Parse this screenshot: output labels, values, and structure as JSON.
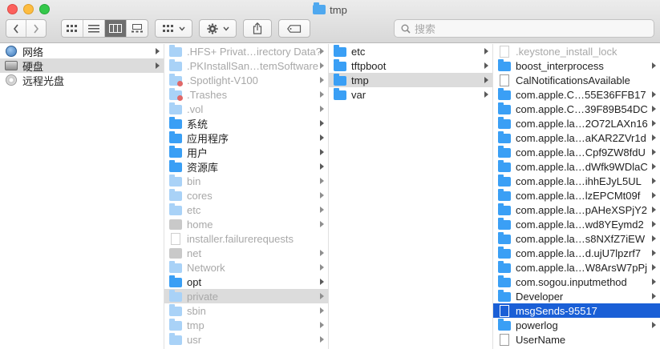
{
  "window": {
    "title": "tmp"
  },
  "toolbar": {
    "back_icon": "chevron-left-icon",
    "forward_icon": "chevron-right-icon",
    "view_modes": [
      "icon-view-icon",
      "list-view-icon",
      "column-view-icon",
      "gallery-view-icon"
    ],
    "active_view": "column-view-icon",
    "group_icon": "group-grid-icon",
    "action_icon": "gear-icon",
    "share_icon": "share-icon",
    "tag_icon": "tag-icon",
    "search_placeholder": "搜索"
  },
  "colors": {
    "selection_blue": "#1a5fd6",
    "selection_gray": "#dcdcdc",
    "folder_blue": "#3a9ff5",
    "folder_dim": "#a9d2f7"
  },
  "columns": [
    {
      "items": [
        {
          "label": "网络",
          "icon": "globe-icon",
          "dim": false,
          "arrow": true,
          "selected": ""
        },
        {
          "label": "硬盘",
          "icon": "hard-disk-icon",
          "dim": false,
          "arrow": true,
          "selected": "gray"
        },
        {
          "label": "远程光盘",
          "icon": "optical-disc-icon",
          "dim": false,
          "arrow": false,
          "selected": ""
        }
      ]
    },
    {
      "items": [
        {
          "label": ".HFS+ Privat…irectory Data?",
          "icon": "folder-icon",
          "dim": true,
          "arrow": true,
          "selected": ""
        },
        {
          "label": ".PKInstallSan…temSoftware",
          "icon": "folder-icon",
          "dim": true,
          "arrow": true,
          "selected": ""
        },
        {
          "label": ".Spotlight-V100",
          "icon": "restricted-folder-icon",
          "dim": true,
          "arrow": true,
          "selected": ""
        },
        {
          "label": ".Trashes",
          "icon": "restricted-folder-icon",
          "dim": true,
          "arrow": true,
          "selected": ""
        },
        {
          "label": ".vol",
          "icon": "folder-icon",
          "dim": true,
          "arrow": true,
          "selected": ""
        },
        {
          "label": "系统",
          "icon": "system-folder-icon",
          "dim": false,
          "arrow": true,
          "selected": ""
        },
        {
          "label": "应用程序",
          "icon": "applications-folder-icon",
          "dim": false,
          "arrow": true,
          "selected": ""
        },
        {
          "label": "用户",
          "icon": "users-folder-icon",
          "dim": false,
          "arrow": true,
          "selected": ""
        },
        {
          "label": "资源库",
          "icon": "library-folder-icon",
          "dim": false,
          "arrow": true,
          "selected": ""
        },
        {
          "label": "bin",
          "icon": "folder-icon",
          "dim": true,
          "arrow": true,
          "selected": ""
        },
        {
          "label": "cores",
          "icon": "folder-icon",
          "dim": true,
          "arrow": true,
          "selected": ""
        },
        {
          "label": "etc",
          "icon": "alias-folder-icon",
          "dim": true,
          "arrow": true,
          "selected": ""
        },
        {
          "label": "home",
          "icon": "home-server-icon",
          "dim": true,
          "arrow": true,
          "selected": ""
        },
        {
          "label": "installer.failurerequests",
          "icon": "file-icon",
          "dim": true,
          "arrow": false,
          "selected": ""
        },
        {
          "label": "net",
          "icon": "server-icon",
          "dim": true,
          "arrow": true,
          "selected": ""
        },
        {
          "label": "Network",
          "icon": "folder-icon",
          "dim": true,
          "arrow": true,
          "selected": ""
        },
        {
          "label": "opt",
          "icon": "folder-icon",
          "dim": false,
          "arrow": true,
          "selected": ""
        },
        {
          "label": "private",
          "icon": "folder-icon",
          "dim": true,
          "arrow": true,
          "selected": "gray"
        },
        {
          "label": "sbin",
          "icon": "folder-icon",
          "dim": true,
          "arrow": true,
          "selected": ""
        },
        {
          "label": "tmp",
          "icon": "alias-folder-icon",
          "dim": true,
          "arrow": true,
          "selected": ""
        },
        {
          "label": "usr",
          "icon": "folder-icon",
          "dim": true,
          "arrow": true,
          "selected": ""
        }
      ]
    },
    {
      "items": [
        {
          "label": "etc",
          "icon": "folder-icon",
          "dim": false,
          "arrow": true,
          "selected": ""
        },
        {
          "label": "tftpboot",
          "icon": "folder-icon",
          "dim": false,
          "arrow": true,
          "selected": ""
        },
        {
          "label": "tmp",
          "icon": "folder-icon",
          "dim": false,
          "arrow": true,
          "selected": "gray"
        },
        {
          "label": "var",
          "icon": "folder-icon",
          "dim": false,
          "arrow": true,
          "selected": ""
        }
      ]
    },
    {
      "items": [
        {
          "label": ".keystone_install_lock",
          "icon": "file-icon",
          "dim": true,
          "arrow": false,
          "selected": ""
        },
        {
          "label": "boost_interprocess",
          "icon": "folder-icon",
          "dim": false,
          "arrow": true,
          "selected": ""
        },
        {
          "label": "CalNotificationsAvailable",
          "icon": "file-icon",
          "dim": false,
          "arrow": false,
          "selected": ""
        },
        {
          "label": "com.apple.C…55E36FFB17",
          "icon": "folder-icon",
          "dim": false,
          "arrow": true,
          "selected": ""
        },
        {
          "label": "com.apple.C…39F89B54DC",
          "icon": "folder-icon",
          "dim": false,
          "arrow": true,
          "selected": ""
        },
        {
          "label": "com.apple.la…2O72LAXn16",
          "icon": "folder-icon",
          "dim": false,
          "arrow": true,
          "selected": ""
        },
        {
          "label": "com.apple.la…aKAR2ZVr1d",
          "icon": "folder-icon",
          "dim": false,
          "arrow": true,
          "selected": ""
        },
        {
          "label": "com.apple.la…Cpf9ZW8fdU",
          "icon": "folder-icon",
          "dim": false,
          "arrow": true,
          "selected": ""
        },
        {
          "label": "com.apple.la…dWfk9WDlaC",
          "icon": "folder-icon",
          "dim": false,
          "arrow": true,
          "selected": ""
        },
        {
          "label": "com.apple.la…ihhEJyL5UL",
          "icon": "folder-icon",
          "dim": false,
          "arrow": true,
          "selected": ""
        },
        {
          "label": "com.apple.la…lzEPCMt09f",
          "icon": "folder-icon",
          "dim": false,
          "arrow": true,
          "selected": ""
        },
        {
          "label": "com.apple.la…pAHeXSPjY2",
          "icon": "folder-icon",
          "dim": false,
          "arrow": true,
          "selected": ""
        },
        {
          "label": "com.apple.la…wd8YEymd2",
          "icon": "folder-icon",
          "dim": false,
          "arrow": true,
          "selected": ""
        },
        {
          "label": "com.apple.la…s8NXfZ7iEW",
          "icon": "folder-icon",
          "dim": false,
          "arrow": true,
          "selected": ""
        },
        {
          "label": "com.apple.la…d.ujU7lpzrf7",
          "icon": "folder-icon",
          "dim": false,
          "arrow": true,
          "selected": ""
        },
        {
          "label": "com.apple.la…W8ArsW7pPj",
          "icon": "folder-icon",
          "dim": false,
          "arrow": true,
          "selected": ""
        },
        {
          "label": "com.sogou.inputmethod",
          "icon": "folder-icon",
          "dim": false,
          "arrow": true,
          "selected": ""
        },
        {
          "label": "Developer",
          "icon": "folder-icon",
          "dim": false,
          "arrow": true,
          "selected": ""
        },
        {
          "label": "msgSends-95517",
          "icon": "file-icon",
          "dim": false,
          "arrow": false,
          "selected": "blue"
        },
        {
          "label": "powerlog",
          "icon": "folder-icon",
          "dim": false,
          "arrow": true,
          "selected": ""
        },
        {
          "label": "UserName",
          "icon": "file-icon",
          "dim": false,
          "arrow": false,
          "selected": ""
        }
      ]
    }
  ]
}
